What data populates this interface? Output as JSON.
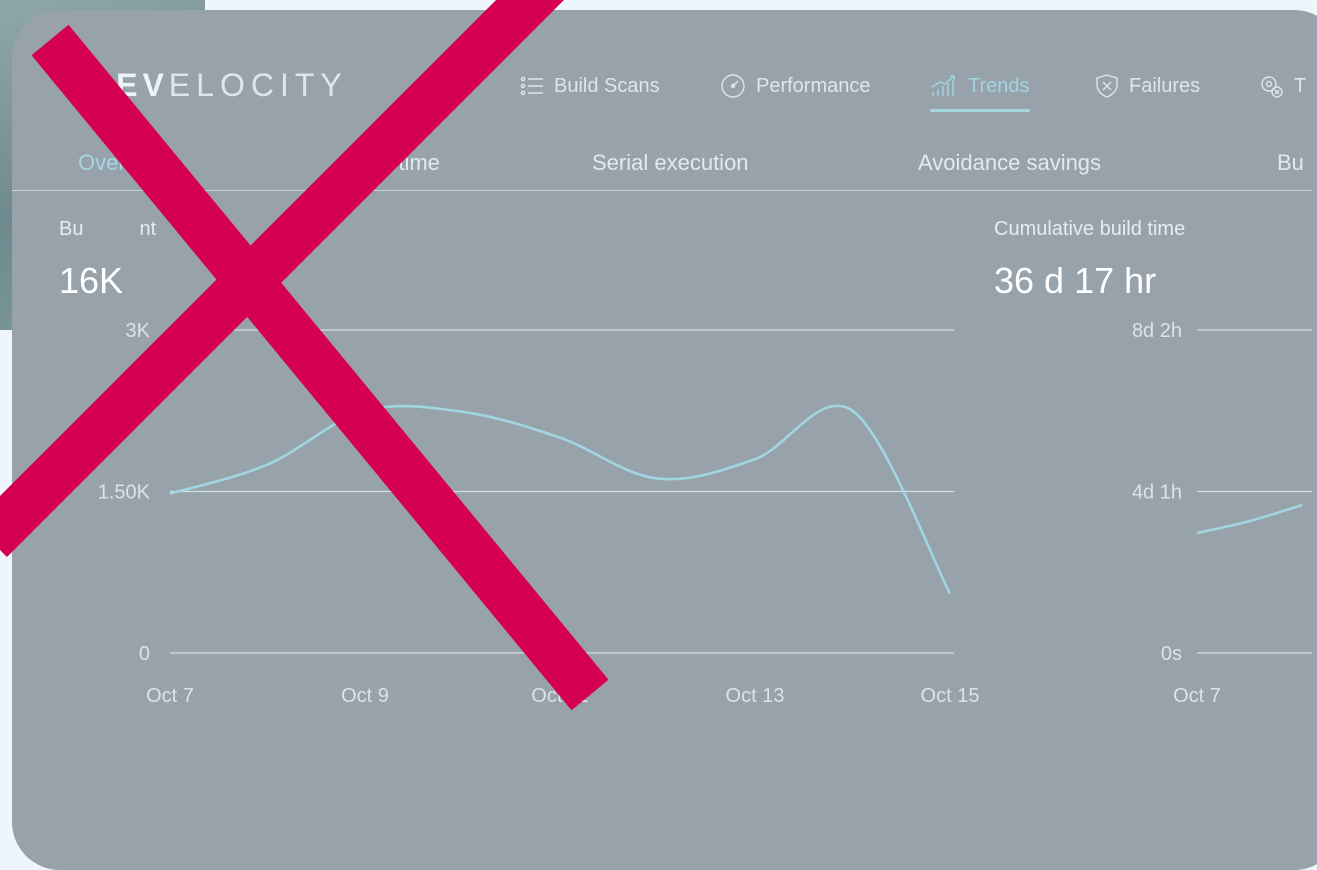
{
  "app": {
    "logo_bold": "DEV",
    "logo_light": "ELOCITY"
  },
  "nav": [
    {
      "label": "Build Scans",
      "icon": "list-icon"
    },
    {
      "label": "Performance",
      "icon": "gauge-icon"
    },
    {
      "label": "Trends",
      "icon": "trend-chart-icon",
      "active": true
    },
    {
      "label": "Failures",
      "icon": "shield-x-icon"
    },
    {
      "label": "T",
      "icon": "cog-x-icon"
    }
  ],
  "subtabs": [
    {
      "label": "Overview",
      "active": true
    },
    {
      "label": "d time"
    },
    {
      "label": "Serial execution"
    },
    {
      "label": "Avoidance savings"
    },
    {
      "label": "Bu"
    }
  ],
  "panels": {
    "build_count": {
      "title": "Bu",
      "title_tail": "nt",
      "value": "16K"
    },
    "cumulative": {
      "title": "Cumulative build time",
      "value": "36 d 17 hr"
    }
  },
  "colors": {
    "accent": "#9fd6e2",
    "card": "#97a2ab",
    "cross": "#d60051"
  },
  "chart_data": [
    {
      "type": "line",
      "x": [
        "Oct 7",
        "Oct 8",
        "Oct 9",
        "Oct 10",
        "Oct 11",
        "Oct 12",
        "Oct 13",
        "Oct 14",
        "Oct 15"
      ],
      "series": [
        {
          "values": [
            1480,
            1750,
            2250,
            2240,
            2000,
            1620,
            1800,
            2250,
            550
          ]
        }
      ],
      "x_tick_labels": [
        "Oct 7",
        "Oct 9",
        "Oct 11",
        "Oct 13",
        "Oct 15"
      ],
      "y_tick_labels": [
        "0",
        "1.50K",
        "3K"
      ],
      "ylim": [
        0,
        3000
      ],
      "grid": true
    },
    {
      "type": "line",
      "x": [
        "Oct 7",
        "Oct 7.5",
        "Oct 8"
      ],
      "series": [
        {
          "values": [
            3.0,
            3.3,
            3.7
          ]
        }
      ],
      "x_tick_labels": [
        "Oct 7"
      ],
      "y_tick_labels": [
        "0s",
        "4d 1h",
        "8d 2h"
      ],
      "ylim": [
        0,
        8.08
      ],
      "grid": true
    }
  ]
}
